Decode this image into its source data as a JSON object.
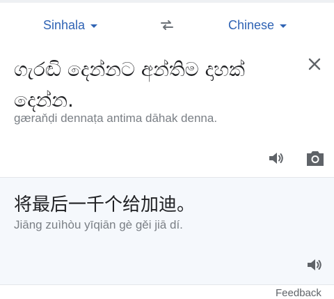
{
  "language_bar": {
    "source_language": "Sinhala",
    "target_language": "Chinese"
  },
  "icons": {
    "swap": "swap-languages-icon",
    "caret": "chevron-down-icon",
    "close": "close-icon",
    "speaker": "speaker-icon",
    "camera": "camera-icon"
  },
  "source": {
    "text": "ගැරඬි දෙන්නට අන්තිම දාහක් දෙන්න.",
    "transliteration": "gæraňḍi dennaṭa antima dāhak denna."
  },
  "translation": {
    "text": "将最后一千个给加迪。",
    "transliteration": "Jiāng zuìhòu yīqiān gè gěi jiā dí."
  },
  "footer": {
    "partial_label": "Feedback"
  },
  "colors": {
    "accent": "#2f63b4",
    "result_background": "#f5f8fc",
    "icon": "#5f6368"
  }
}
